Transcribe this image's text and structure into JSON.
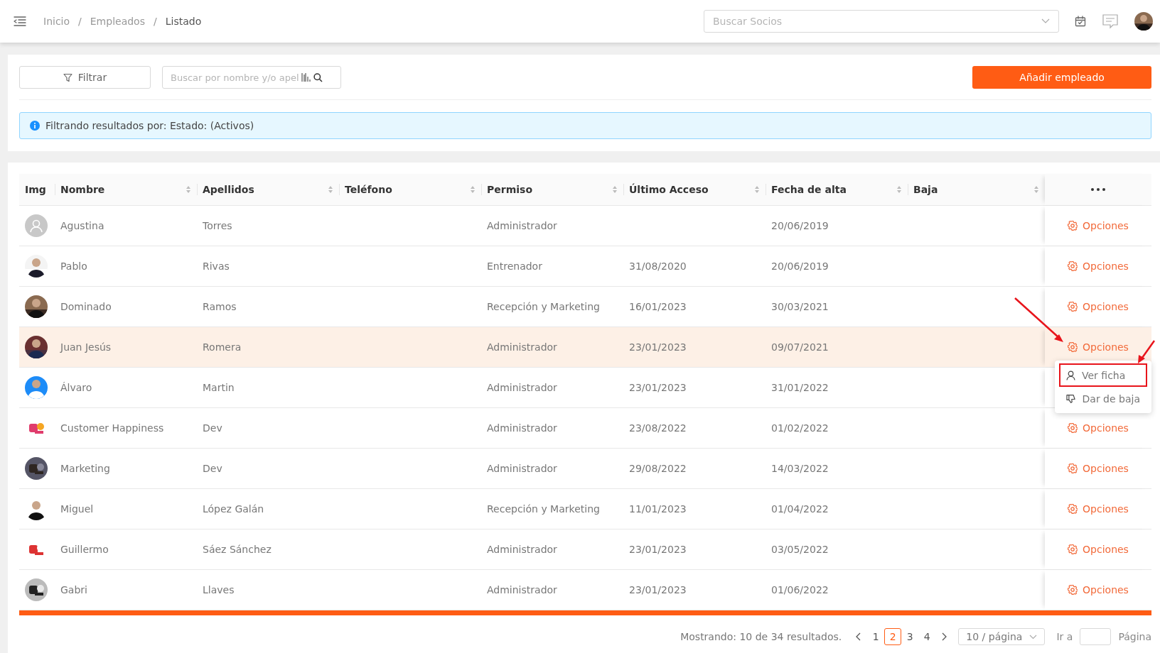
{
  "topbar": {
    "breadcrumb": [
      {
        "kind": "link",
        "label": "Inicio"
      },
      {
        "kind": "separator",
        "label": "/"
      },
      {
        "kind": "link",
        "label": "Empleados"
      },
      {
        "kind": "separator",
        "label": "/"
      },
      {
        "kind": "current",
        "label": "Listado"
      }
    ],
    "partner_search": {
      "placeholder": "Buscar Socios"
    }
  },
  "toolbar": {
    "filter_button": "Filtrar",
    "search": {
      "placeholder": "Buscar por nombre y/o apel"
    },
    "add_button": "Añadir empleado"
  },
  "filter_notice": "Filtrando resultados por: Estado: (Activos)",
  "table": {
    "columns": [
      {
        "label": "Img",
        "sortable": false
      },
      {
        "label": "Nombre",
        "sortable": true
      },
      {
        "label": "Apellidos",
        "sortable": true
      },
      {
        "label": "Teléfono",
        "sortable": true
      },
      {
        "label": "Permiso",
        "sortable": true
      },
      {
        "label": "Último Acceso",
        "sortable": true
      },
      {
        "label": "Fecha de alta",
        "sortable": true
      },
      {
        "label": "Baja",
        "sortable": true
      }
    ],
    "rows": [
      {
        "avatar": {
          "kind": "default"
        },
        "nombre": "Agustina",
        "apellidos": "Torres",
        "permiso": "Administrador",
        "fecha_alta": "20/06/2019",
        "options": "Opciones",
        "selected": false
      },
      {
        "nombre": "Pablo",
        "apellidos": "Rivas",
        "permiso": "Entrenador",
        "ultimo_acceso": "31/08/2020",
        "fecha_alta": "20/06/2019",
        "options": "Opciones",
        "selected": false
      },
      {
        "nombre": "Dominado",
        "apellidos": "Ramos",
        "permiso": "Recepción y Marketing",
        "ultimo_acceso": "16/01/2023",
        "fecha_alta": "30/03/2021",
        "options": "Opciones",
        "selected": false
      },
      {
        "nombre": "Juan Jesús",
        "apellidos": "Romera",
        "permiso": "Administrador",
        "ultimo_acceso": "23/01/2023",
        "fecha_alta": "09/07/2021",
        "options": "Opciones",
        "selected": true,
        "menu": [
          {
            "kind": "user",
            "label": "Ver ficha",
            "highlighted": true
          },
          {
            "kind": "thumbs-down",
            "label": "Dar de baja",
            "highlighted": false
          }
        ]
      },
      {
        "nombre": "Álvaro",
        "apellidos": "Martin",
        "permiso": "Administrador",
        "ultimo_acceso": "23/01/2023",
        "fecha_alta": "31/01/2022",
        "selected": false
      },
      {
        "avatar": {
          "kind": "logo"
        },
        "nombre": "Customer Happiness",
        "apellidos": "Dev",
        "permiso": "Administrador",
        "ultimo_acceso": "23/08/2022",
        "fecha_alta": "01/02/2022",
        "options": "Opciones",
        "selected": false
      },
      {
        "avatar": {
          "kind": "logo"
        },
        "nombre": "Marketing",
        "apellidos": "Dev",
        "permiso": "Administrador",
        "ultimo_acceso": "29/08/2022",
        "fecha_alta": "14/03/2022",
        "options": "Opciones",
        "selected": false
      },
      {
        "nombre": "Miguel",
        "apellidos": "López Galán",
        "permiso": "Recepción y Marketing",
        "ultimo_acceso": "11/01/2023",
        "fecha_alta": "01/04/2022",
        "options": "Opciones",
        "selected": false
      },
      {
        "avatar": {
          "kind": "logo"
        },
        "nombre": "Guillermo",
        "apellidos": "Sáez Sánchez",
        "permiso": "Administrador",
        "ultimo_acceso": "23/01/2023",
        "fecha_alta": "03/05/2022",
        "options": "Opciones",
        "selected": false
      },
      {
        "avatar": {
          "kind": "logo"
        },
        "nombre": "Gabri",
        "apellidos": "Llaves",
        "permiso": "Administrador",
        "ultimo_acceso": "23/01/2023",
        "fecha_alta": "01/06/2022",
        "options": "Opciones",
        "selected": false
      }
    ]
  },
  "pagination": {
    "summary": "Mostrando: 10 de 34 resultados.",
    "pages": [
      {
        "label": "1",
        "selected": false
      },
      {
        "label": "2",
        "selected": true
      },
      {
        "label": "3",
        "selected": false
      },
      {
        "label": "4",
        "selected": false
      }
    ],
    "page_size": "10 / página",
    "goto_label": "Ir a",
    "goto_suffix": "Página"
  },
  "annotations": [
    {
      "kind": "arrow"
    },
    {
      "kind": "arrow"
    }
  ]
}
